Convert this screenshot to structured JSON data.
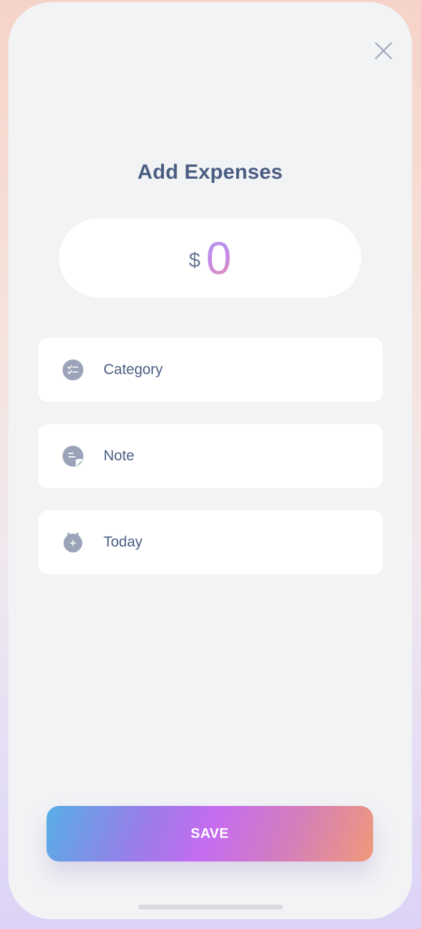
{
  "header": {
    "title": "Add Expenses",
    "close_icon": "close-icon"
  },
  "amount": {
    "currency": "$",
    "value": "0"
  },
  "fields": [
    {
      "label": "Category",
      "icon": "category-checklist-icon"
    },
    {
      "label": "Note",
      "icon": "note-icon"
    },
    {
      "label": "Today",
      "icon": "calendar-date-icon"
    }
  ],
  "actions": {
    "save_label": "SAVE"
  },
  "colors": {
    "text_primary": "#4a5d82",
    "icon_gray": "#9aa3b8",
    "surface": "#f2f3f5",
    "card": "#ffffff"
  }
}
